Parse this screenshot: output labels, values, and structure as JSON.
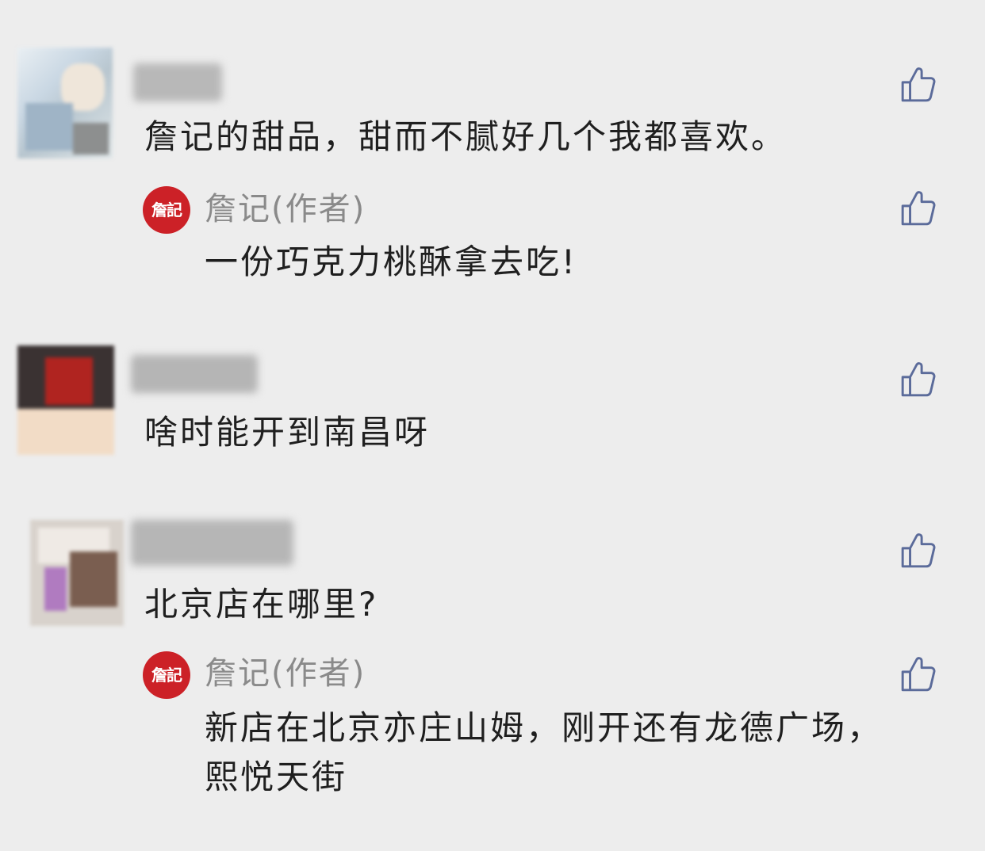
{
  "comments": [
    {
      "text": "詹记的甜品，甜而不腻好几个我都喜欢。",
      "reply": {
        "author_logo": "詹記",
        "author": "詹记(作者)",
        "text": "一份巧克力桃酥拿去吃!"
      }
    },
    {
      "text": "啥时能开到南昌呀"
    },
    {
      "text": "北京店在哪里?",
      "reply": {
        "author_logo": "詹記",
        "author": "詹记(作者)",
        "text": "新店在北京亦庄山姆，刚开还有龙德广场，熙悦天街"
      }
    }
  ],
  "icons": {
    "like": "thumbs-up-icon"
  },
  "colors": {
    "background": "#ededed",
    "like_icon": "#5b6b9a",
    "author_logo_bg": "#cc2127",
    "author_name": "#8a8a8a",
    "comment_text": "#1f1f1f"
  }
}
